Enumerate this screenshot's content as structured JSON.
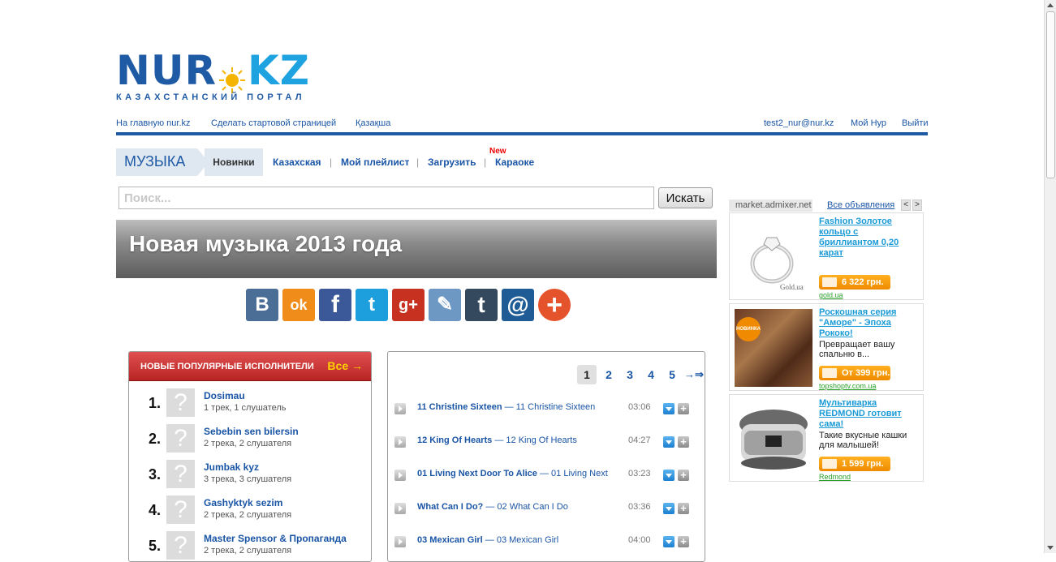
{
  "logo": {
    "part1": "NUR",
    "part2": "KZ",
    "tagline": "КАЗАХСТАНСКИЙ ПОРТАЛ"
  },
  "topnav": {
    "left": [
      "На главную nur.kz",
      "Сделать стартовой страницей",
      "Қазақша"
    ],
    "right": [
      "test2_nur@nur.kz",
      "Мой Нур",
      "Выйти"
    ]
  },
  "music": {
    "section": "МУЗЫКА",
    "active_tab": "Новинки",
    "tabs": [
      "Казахская",
      "Мой плейлист",
      "Загрузить",
      "Караоке"
    ],
    "sep": "|",
    "new_badge": "New"
  },
  "search": {
    "placeholder": "Поиск...",
    "button": "Искать"
  },
  "banner": {
    "title": "Новая музыка 2013 года"
  },
  "social": {
    "buttons": [
      {
        "name": "vkontakte-icon",
        "glyph": "В",
        "color": "#4b6e96"
      },
      {
        "name": "odnoklassniki-icon",
        "glyph": "ok",
        "color": "#f08c1a"
      },
      {
        "name": "facebook-icon",
        "glyph": "f",
        "color": "#3b5998"
      },
      {
        "name": "twitter-icon",
        "glyph": "t",
        "color": "#1e9fdd"
      },
      {
        "name": "googleplus-icon",
        "glyph": "g+",
        "color": "#c7311f"
      },
      {
        "name": "livejournal-icon",
        "glyph": "✎",
        "color": "#6d98c4"
      },
      {
        "name": "tumblr-icon",
        "glyph": "t",
        "color": "#35495e"
      },
      {
        "name": "mailru-icon",
        "glyph": "@",
        "color": "#1f5c96"
      },
      {
        "name": "more-share-icon",
        "glyph": "+",
        "color": "#e5532d"
      }
    ]
  },
  "artists": {
    "header": "НОВЫЕ ПОПУЛЯРНЫЕ ИСПОЛНИТЕЛИ",
    "all": "Все →",
    "placeholder_glyph": "?",
    "items": [
      {
        "num": "1.",
        "name": "Dosimau",
        "info": "1 трек, 1 слушатель"
      },
      {
        "num": "2.",
        "name": "Sebebin sen bilersin",
        "info": "2 трека, 2 слушателя"
      },
      {
        "num": "3.",
        "name": "Jumbak kyz",
        "info": "3 трека, 3 слушателя"
      },
      {
        "num": "4.",
        "name": "Gashyktyk sezim",
        "info": "2 трека, 2 слушателя"
      },
      {
        "num": "5.",
        "name": "Master Spensor & Пропаганда",
        "info": "2 трека, 2 слушателя"
      }
    ]
  },
  "tracks": {
    "pages": [
      "1",
      "2",
      "3",
      "4",
      "5"
    ],
    "current_page": "1",
    "next": "→⇒",
    "add_glyph": "+",
    "items": [
      {
        "artist": "11 Christine Sixteen",
        "title": "— 11 Christine Sixteen",
        "duration": "03:06"
      },
      {
        "artist": "12 King Of Hearts",
        "title": "— 12 King Of Hearts",
        "duration": "04:27"
      },
      {
        "artist": "01 Living Next Door To Alice",
        "title": "— 01 Living Next",
        "duration": "03:23"
      },
      {
        "artist": "What Can I Do?",
        "title": "— 02 What Can I Do",
        "duration": "03:36"
      },
      {
        "artist": "03 Mexican Girl",
        "title": "— 03 Mexican Girl",
        "duration": "04:00"
      }
    ]
  },
  "ads": {
    "source": "market.admixer.net",
    "all_link": "Все объявления",
    "prev": "<",
    "next": ">",
    "items": [
      {
        "title": "Fashion Золотое кольцо с бриллиантом 0,20 карат",
        "desc": "",
        "price": "6 322 грн.",
        "shop": "gold.ua",
        "image_label": "Gold.ua"
      },
      {
        "title": "Роскошная серия \"Аморе\" - Эпоха Рококо!",
        "desc": "Превращает вашу спальню в...",
        "price": "От 399 грн.",
        "shop": "topshoptv.com.ua",
        "image_label": "НОВИНКА"
      },
      {
        "title": "Мультиварка REDMOND готовит сама!",
        "desc": "Такие вкусные кашки для малышей!",
        "price": "1 599 грн.",
        "shop": "Redmond",
        "image_label": ""
      }
    ]
  }
}
